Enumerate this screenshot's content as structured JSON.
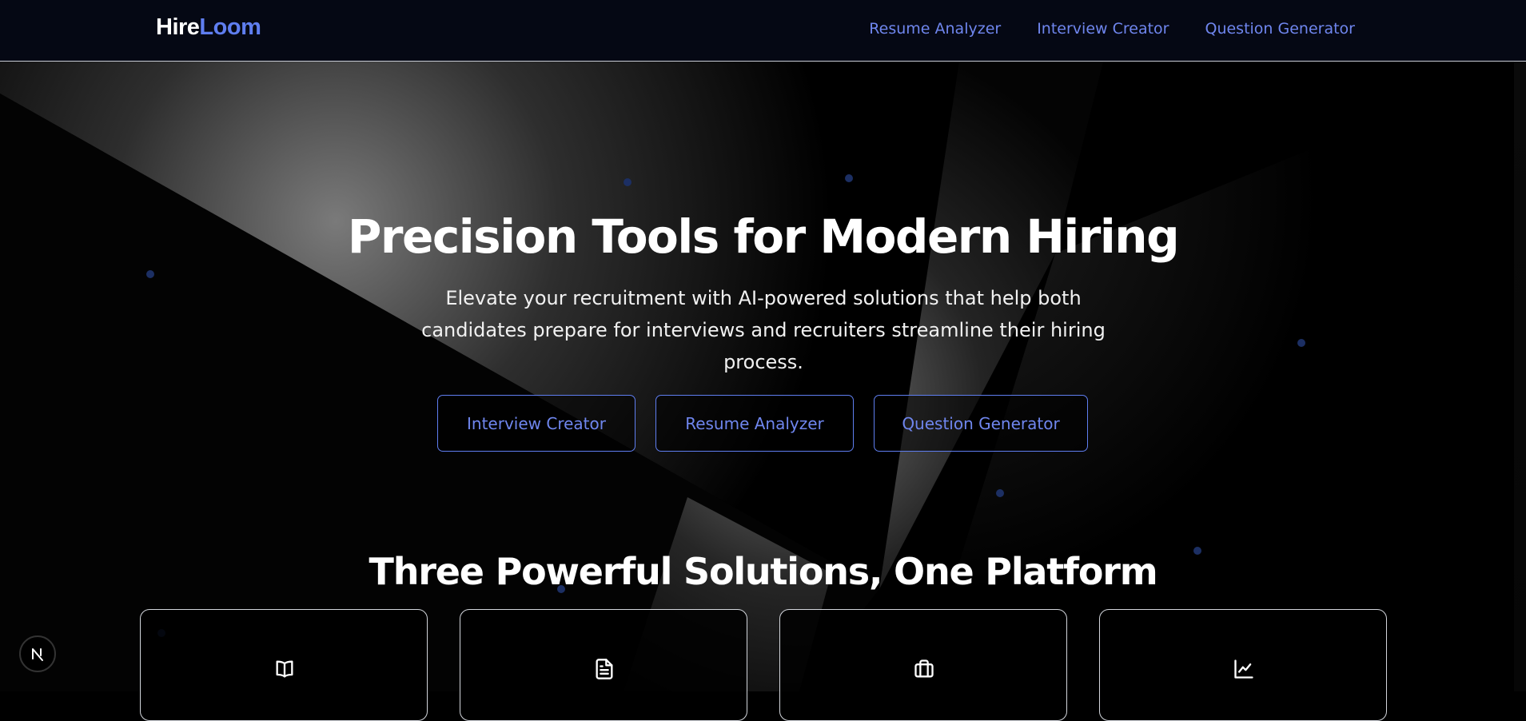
{
  "header": {
    "logo_part1": "Hire",
    "logo_part2": "Loom",
    "nav": [
      {
        "label": "Resume Analyzer"
      },
      {
        "label": "Interview Creator"
      },
      {
        "label": "Question Generator"
      }
    ]
  },
  "hero": {
    "title": "Precision Tools for Modern Hiring",
    "subtitle": "Elevate your recruitment with AI-powered solutions that help both candidates prepare for interviews and recruiters streamline their hiring process.",
    "buttons": [
      {
        "label": "Interview Creator"
      },
      {
        "label": "Resume Analyzer"
      },
      {
        "label": "Question Generator"
      }
    ]
  },
  "solutions": {
    "title": "Three Powerful Solutions, One Platform",
    "cards": [
      {
        "icon": "book-open-icon"
      },
      {
        "icon": "document-icon"
      },
      {
        "icon": "briefcase-icon"
      },
      {
        "icon": "line-chart-icon"
      }
    ]
  },
  "colors": {
    "accent": "#5f7ef0",
    "nav_text": "#6f86ee",
    "header_bg": "#050814",
    "page_bg": "#000000",
    "dot": "#1c2f63"
  },
  "badge": {
    "letter": "N"
  }
}
